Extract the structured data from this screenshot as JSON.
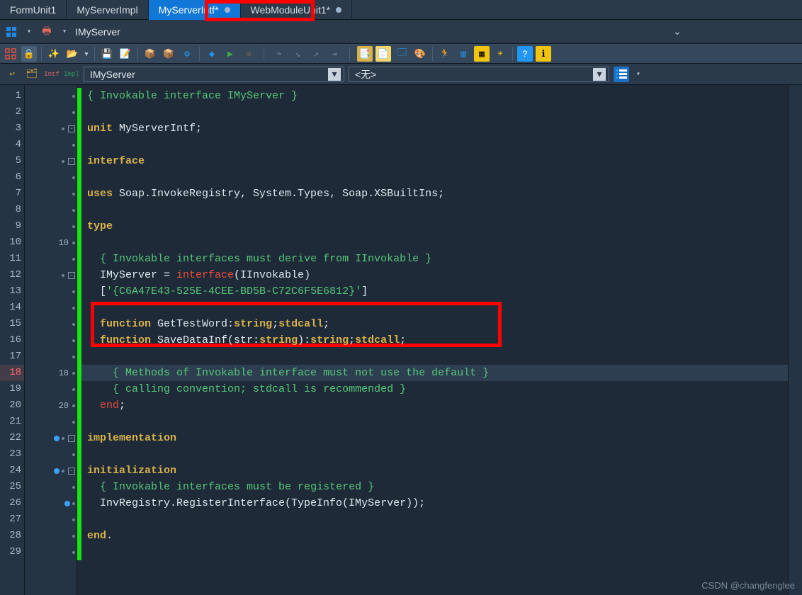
{
  "tabs": [
    {
      "label": "FormUnit1",
      "modified": false,
      "active": false
    },
    {
      "label": "MyServerImpl",
      "modified": false,
      "active": false
    },
    {
      "label": "MyServerIntf*",
      "modified": true,
      "active": true
    },
    {
      "label": "WebModuleUnit1*",
      "modified": true,
      "active": false
    }
  ],
  "breadcrumb": "IMyServer",
  "nav": {
    "class_combo": "IMyServer",
    "method_combo": "<无>"
  },
  "code": {
    "lines": [
      {
        "n": 1,
        "seg": [
          [
            "cm",
            "{ Invokable interface IMyServer }"
          ]
        ]
      },
      {
        "n": 2,
        "seg": []
      },
      {
        "n": 3,
        "fold": "-",
        "seg": [
          [
            "kw",
            "unit"
          ],
          [
            "pl",
            " MyServerIntf;"
          ]
        ]
      },
      {
        "n": 4,
        "seg": []
      },
      {
        "n": 5,
        "fold": "-",
        "seg": [
          [
            "kw",
            "interface"
          ]
        ]
      },
      {
        "n": 6,
        "seg": []
      },
      {
        "n": 7,
        "seg": [
          [
            "kw",
            "uses"
          ],
          [
            "pl",
            " Soap.InvokeRegistry, System.Types, Soap.XSBuiltIns;"
          ]
        ]
      },
      {
        "n": 8,
        "seg": []
      },
      {
        "n": 9,
        "seg": [
          [
            "kw",
            "type"
          ]
        ]
      },
      {
        "n": 10,
        "mnum": "10",
        "seg": []
      },
      {
        "n": 11,
        "seg": [
          [
            "pl",
            "  "
          ],
          [
            "cm",
            "{ Invokable interfaces must derive from IInvokable }"
          ]
        ]
      },
      {
        "n": 12,
        "fold": "-",
        "seg": [
          [
            "pl",
            "  IMyServer = "
          ],
          [
            "kw-red",
            "interface"
          ],
          [
            "pl",
            "(IInvokable)"
          ]
        ]
      },
      {
        "n": 13,
        "seg": [
          [
            "pl",
            "  ["
          ],
          [
            "str",
            "'{C6A47E43-525E-4CEE-BD5B-C72C6F5E6812}'"
          ],
          [
            "pl",
            "]"
          ]
        ]
      },
      {
        "n": 14,
        "seg": []
      },
      {
        "n": 15,
        "seg": [
          [
            "pl",
            "  "
          ],
          [
            "kw",
            "function"
          ],
          [
            "pl",
            " GetTestWord:"
          ],
          [
            "kw",
            "string"
          ],
          [
            "pl",
            ";"
          ],
          [
            "kw",
            "stdcall"
          ],
          [
            "pl",
            ";"
          ]
        ]
      },
      {
        "n": 16,
        "seg": [
          [
            "pl",
            "  "
          ],
          [
            "kw",
            "function"
          ],
          [
            "pl",
            " SaveDataInf(str:"
          ],
          [
            "kw",
            "string"
          ],
          [
            "pl",
            "):"
          ],
          [
            "kw",
            "string"
          ],
          [
            "pl",
            ";"
          ],
          [
            "kw",
            "stdcall"
          ],
          [
            "pl",
            ";"
          ]
        ]
      },
      {
        "n": 17,
        "seg": []
      },
      {
        "n": 18,
        "cur": true,
        "mnum": "18",
        "seg": [
          [
            "pl",
            "    "
          ],
          [
            "cm",
            "{ Methods of Invokable interface must not use the default }"
          ]
        ]
      },
      {
        "n": 19,
        "seg": [
          [
            "pl",
            "    "
          ],
          [
            "cm",
            "{ calling convention; stdcall is recommended }"
          ]
        ]
      },
      {
        "n": 20,
        "mnum": "20",
        "seg": [
          [
            "pl",
            "  "
          ],
          [
            "kw-red",
            "end"
          ],
          [
            "pl",
            ";"
          ]
        ]
      },
      {
        "n": 21,
        "seg": []
      },
      {
        "n": 22,
        "bp": true,
        "fold": "-",
        "seg": [
          [
            "kw",
            "implementation"
          ]
        ]
      },
      {
        "n": 23,
        "seg": []
      },
      {
        "n": 24,
        "bp": true,
        "fold": "-",
        "seg": [
          [
            "kw",
            "initialization"
          ]
        ]
      },
      {
        "n": 25,
        "seg": [
          [
            "pl",
            "  "
          ],
          [
            "cm",
            "{ Invokable interfaces must be registered }"
          ]
        ]
      },
      {
        "n": 26,
        "bp": true,
        "seg": [
          [
            "pl",
            "  InvRegistry.RegisterInterface(TypeInfo(IMyServer));"
          ]
        ]
      },
      {
        "n": 27,
        "seg": []
      },
      {
        "n": 28,
        "seg": [
          [
            "kw",
            "end"
          ],
          [
            "pl",
            "."
          ]
        ]
      },
      {
        "n": 29,
        "seg": []
      }
    ]
  },
  "watermark": "CSDN @changfenglee"
}
